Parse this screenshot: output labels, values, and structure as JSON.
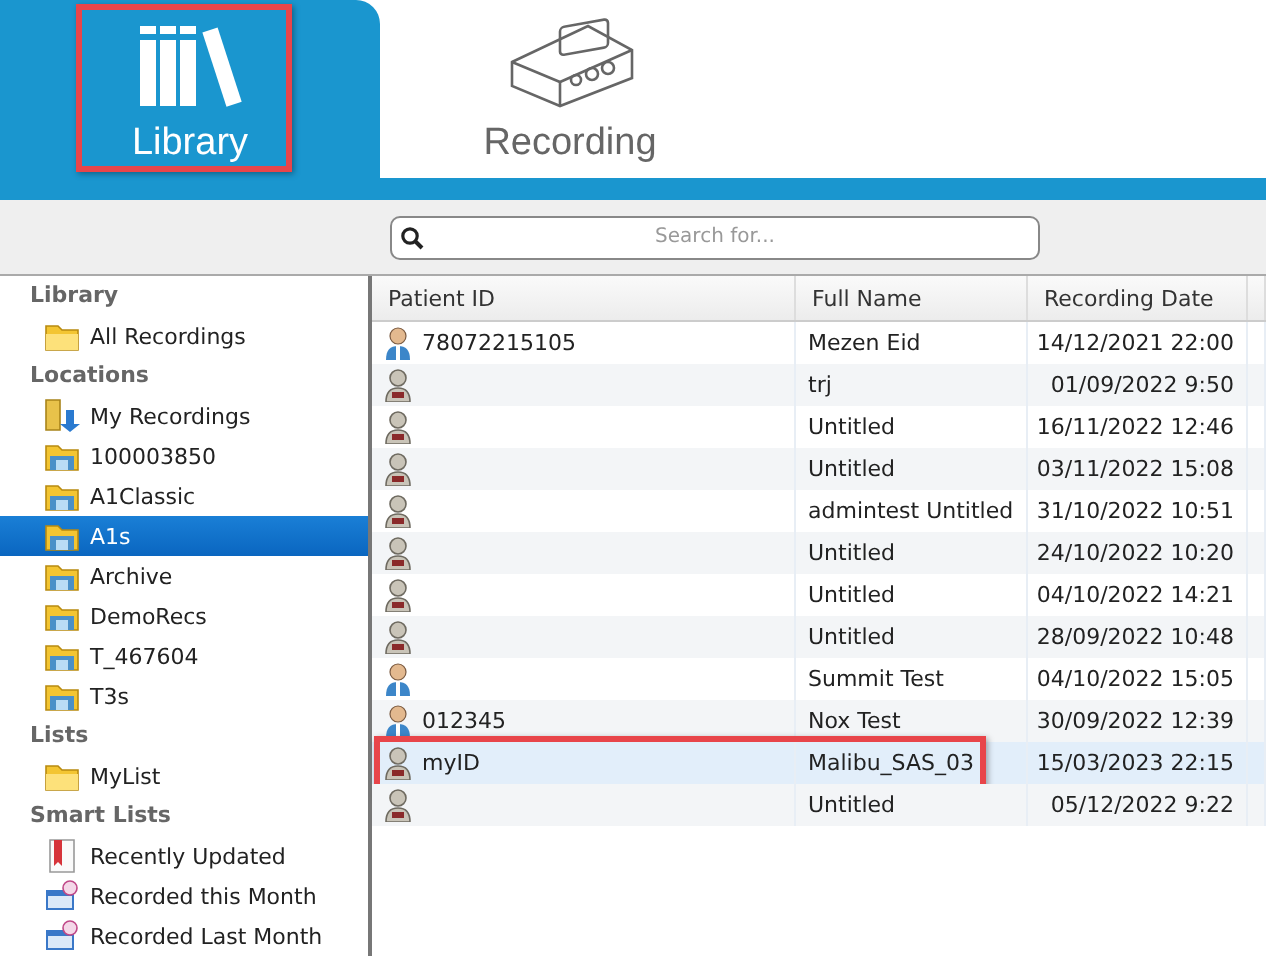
{
  "tabs": [
    {
      "label": "Library",
      "kind": "library",
      "selected": true,
      "highlighted": true
    },
    {
      "label": "Recording",
      "kind": "device",
      "selected": false,
      "highlighted": false
    }
  ],
  "search": {
    "placeholder": "Search for..."
  },
  "sidebar": [
    {
      "heading": "Library",
      "items": [
        {
          "label": "All Recordings",
          "kind": "folder",
          "selected": false
        }
      ]
    },
    {
      "heading": "Locations",
      "items": [
        {
          "label": "My Recordings",
          "kind": "download-folder",
          "selected": false
        },
        {
          "label": "100003850",
          "kind": "network-folder",
          "selected": false
        },
        {
          "label": "A1Classic",
          "kind": "network-folder",
          "selected": false
        },
        {
          "label": "A1s",
          "kind": "network-folder",
          "selected": true
        },
        {
          "label": "Archive",
          "kind": "network-folder",
          "selected": false
        },
        {
          "label": "DemoRecs",
          "kind": "network-folder",
          "selected": false
        },
        {
          "label": "T_467604",
          "kind": "network-folder",
          "selected": false
        },
        {
          "label": "T3s",
          "kind": "network-folder",
          "selected": false
        }
      ]
    },
    {
      "heading": "Lists",
      "items": [
        {
          "label": "MyList",
          "kind": "folder",
          "selected": false
        }
      ]
    },
    {
      "heading": "Smart Lists",
      "items": [
        {
          "label": "Recently Updated",
          "kind": "document",
          "selected": false
        },
        {
          "label": "Recorded this Month",
          "kind": "calendar",
          "selected": false
        },
        {
          "label": "Recorded Last Month",
          "kind": "calendar",
          "selected": false
        }
      ]
    }
  ],
  "table": {
    "columns": [
      "Patient ID",
      "Full Name",
      "Recording Date"
    ],
    "rows": [
      {
        "patient_id": "78072215105",
        "full_name": "Mezen Eid",
        "recording_date": "14/12/2021 22:00",
        "kind": "patient",
        "selected": false,
        "highlighted": false
      },
      {
        "full_name": "trj",
        "recording_date": "01/09/2022 9:50",
        "kind": "anonymous",
        "selected": false,
        "highlighted": false
      },
      {
        "full_name": "Untitled",
        "recording_date": "16/11/2022 12:46",
        "kind": "anonymous",
        "selected": false,
        "highlighted": false
      },
      {
        "full_name": "Untitled",
        "recording_date": "03/11/2022 15:08",
        "kind": "anonymous",
        "selected": false,
        "highlighted": false
      },
      {
        "full_name": "admintest Untitled",
        "recording_date": "31/10/2022 10:51",
        "kind": "anonymous",
        "selected": false,
        "highlighted": false
      },
      {
        "full_name": "Untitled",
        "recording_date": "24/10/2022 10:20",
        "kind": "anonymous",
        "selected": false,
        "highlighted": false
      },
      {
        "full_name": "Untitled",
        "recording_date": "04/10/2022 14:21",
        "kind": "anonymous",
        "selected": false,
        "highlighted": false
      },
      {
        "full_name": "Untitled",
        "recording_date": "28/09/2022 10:48",
        "kind": "anonymous",
        "selected": false,
        "highlighted": false
      },
      {
        "full_name": "Summit Test",
        "recording_date": "04/10/2022 15:05",
        "kind": "patient",
        "selected": false,
        "highlighted": false
      },
      {
        "patient_id": "012345",
        "full_name": "Nox Test",
        "recording_date": "30/09/2022 12:39",
        "kind": "patient",
        "selected": false,
        "highlighted": false
      },
      {
        "patient_id": "myID",
        "full_name": "Malibu_SAS_03",
        "recording_date": "15/03/2023 22:15",
        "kind": "anonymous",
        "selected": true,
        "highlighted": true
      },
      {
        "full_name": "Untitled",
        "recording_date": "05/12/2022 9:22",
        "kind": "anonymous",
        "selected": false,
        "highlighted": false
      }
    ]
  }
}
